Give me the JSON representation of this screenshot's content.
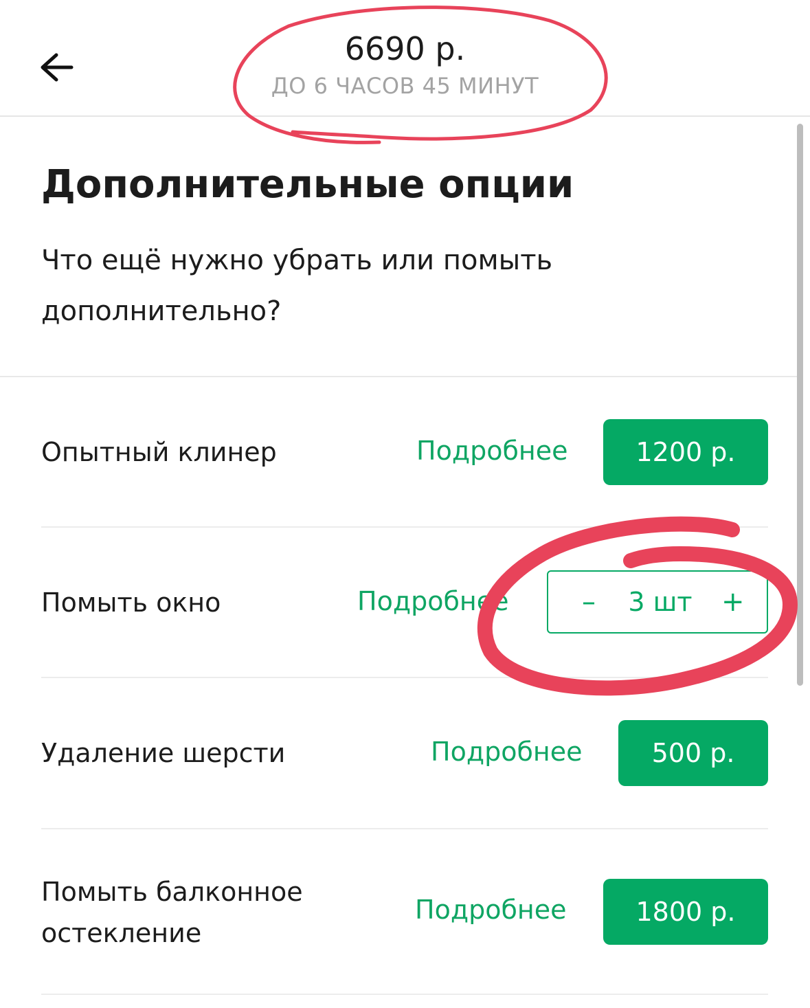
{
  "header": {
    "back_icon": "arrow-left-icon",
    "total_price": "6690 р.",
    "duration": "ДО 6 ЧАСОВ 45 МИНУТ"
  },
  "intro": {
    "title": "Дополнительные опции",
    "subtitle": "Что ещё нужно убрать или помыть дополнительно?"
  },
  "options": [
    {
      "label": "Опытный клинер",
      "more": "Подробнее",
      "price": "1200 р."
    },
    {
      "label": "Помыть окно",
      "more": "Подробнее",
      "quantity": "3 шт",
      "minus": "–",
      "plus": "+"
    },
    {
      "label": "Удаление шерсти",
      "more": "Подробнее",
      "price": "500 р."
    },
    {
      "label": "Помыть балконное остекление",
      "more": "Подробнее",
      "price": "1800 р."
    }
  ],
  "colors": {
    "accent": "#05a964",
    "link": "#0fa563",
    "annotation": "#e8435a",
    "muted_text": "#a3a3a3"
  }
}
